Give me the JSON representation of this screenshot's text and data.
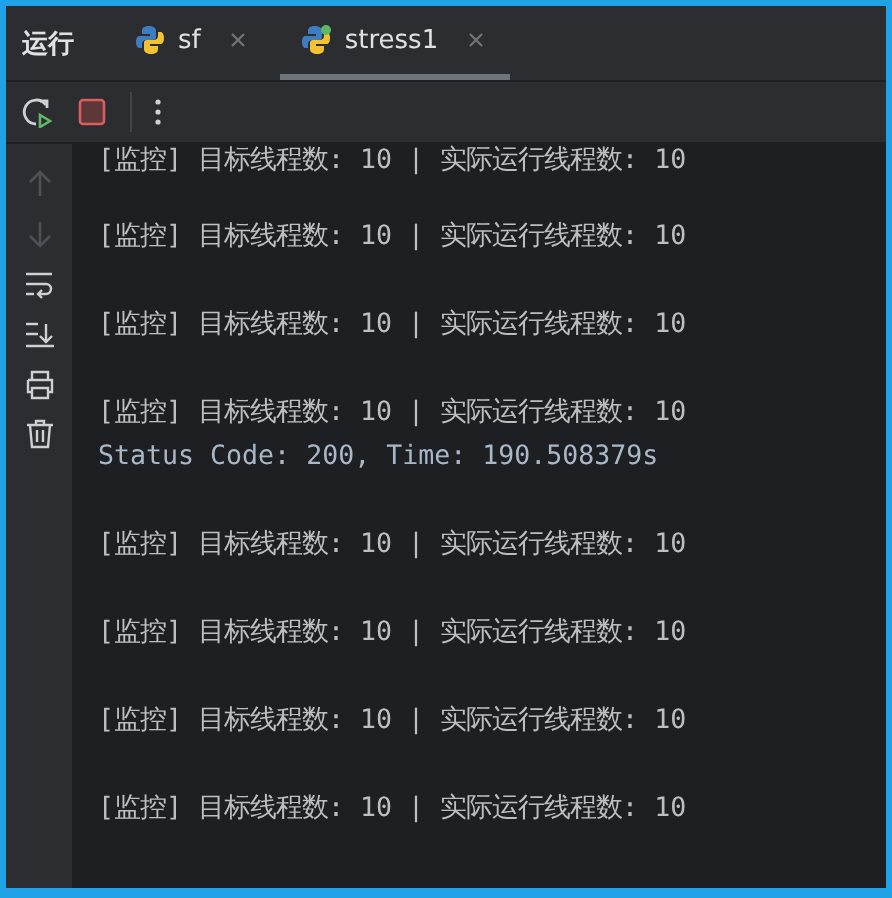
{
  "panel": {
    "title": "运行"
  },
  "tabs": [
    {
      "label": "sf",
      "selected": false
    },
    {
      "label": "stress1",
      "selected": true
    }
  ],
  "gutter_tools": [
    {
      "kind": "up",
      "disabled": true
    },
    {
      "kind": "down",
      "disabled": true
    },
    {
      "kind": "wrap",
      "disabled": false
    },
    {
      "kind": "scroll-end",
      "disabled": false
    },
    {
      "kind": "print",
      "disabled": false
    },
    {
      "kind": "trash",
      "disabled": false
    }
  ],
  "output": [
    {
      "kind": "monitor",
      "text": "[监控] 目标线程数: 10 | 实际运行线程数: 10"
    },
    {
      "kind": "blank"
    },
    {
      "kind": "monitor",
      "text": "[监控] 目标线程数: 10 | 实际运行线程数: 10"
    },
    {
      "kind": "blank"
    },
    {
      "kind": "monitor",
      "text": "[监控] 目标线程数: 10 | 实际运行线程数: 10"
    },
    {
      "kind": "blank"
    },
    {
      "kind": "monitor",
      "text": "[监控] 目标线程数: 10 | 实际运行线程数: 10"
    },
    {
      "kind": "status",
      "text": "Status Code: 200, Time: 190.508379s"
    },
    {
      "kind": "blank"
    },
    {
      "kind": "monitor",
      "text": "[监控] 目标线程数: 10 | 实际运行线程数: 10"
    },
    {
      "kind": "blank"
    },
    {
      "kind": "monitor",
      "text": "[监控] 目标线程数: 10 | 实际运行线程数: 10"
    },
    {
      "kind": "blank"
    },
    {
      "kind": "monitor",
      "text": "[监控] 目标线程数: 10 | 实际运行线程数: 10"
    },
    {
      "kind": "blank"
    },
    {
      "kind": "monitor",
      "text": "[监控] 目标线程数: 10 | 实际运行线程数: 10"
    }
  ]
}
